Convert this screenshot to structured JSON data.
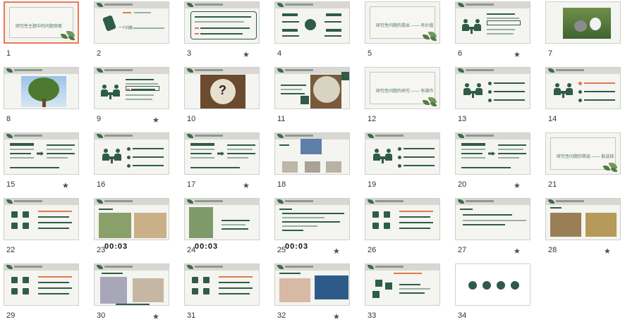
{
  "slides": [
    {
      "number": "1",
      "title": "研究性主题中的问题探索",
      "star": false,
      "selected": true
    },
    {
      "number": "2",
      "title": "一个问题",
      "star": false
    },
    {
      "number": "3",
      "title": "",
      "star": true
    },
    {
      "number": "4",
      "title": "",
      "star": false
    },
    {
      "number": "5",
      "title": "研究性问题的提出 —— 有价值",
      "star": false
    },
    {
      "number": "6",
      "title": "",
      "star": true
    },
    {
      "number": "7",
      "title": "",
      "star": false
    },
    {
      "number": "8",
      "title": "",
      "star": false
    },
    {
      "number": "9",
      "title": "",
      "star": true
    },
    {
      "number": "10",
      "title": "",
      "star": false
    },
    {
      "number": "11",
      "title": "",
      "star": false
    },
    {
      "number": "12",
      "title": "研究性问题的研究 —— 有操作",
      "star": false
    },
    {
      "number": "13",
      "title": "",
      "star": false
    },
    {
      "number": "14",
      "title": "",
      "star": false
    },
    {
      "number": "15",
      "title": "",
      "star": true
    },
    {
      "number": "16",
      "title": "",
      "star": false
    },
    {
      "number": "17",
      "title": "",
      "star": true
    },
    {
      "number": "18",
      "title": "",
      "star": false
    },
    {
      "number": "19",
      "title": "",
      "star": false
    },
    {
      "number": "20",
      "title": "",
      "star": true
    },
    {
      "number": "21",
      "title": "研究性问题的筛选 —— 能选择",
      "star": false
    },
    {
      "number": "22",
      "title": "",
      "star": false
    },
    {
      "number": "23",
      "title": "",
      "star": false,
      "timer": "00:03"
    },
    {
      "number": "24",
      "title": "",
      "star": false,
      "timer": "00:03"
    },
    {
      "number": "25",
      "title": "",
      "star": true,
      "timer": "00:03"
    },
    {
      "number": "26",
      "title": "",
      "star": false
    },
    {
      "number": "27",
      "title": "",
      "star": true
    },
    {
      "number": "28",
      "title": "",
      "star": true
    },
    {
      "number": "29",
      "title": "",
      "star": false
    },
    {
      "number": "30",
      "title": "",
      "star": true
    },
    {
      "number": "31",
      "title": "",
      "star": false
    },
    {
      "number": "32",
      "title": "",
      "star": true
    },
    {
      "number": "33",
      "title": "",
      "star": false
    },
    {
      "number": "34",
      "title": "",
      "star": false
    }
  ],
  "star_glyph": "★",
  "colors": {
    "accent": "#2f5c47",
    "selection": "#e8795a",
    "orange": "#e07a4a"
  }
}
